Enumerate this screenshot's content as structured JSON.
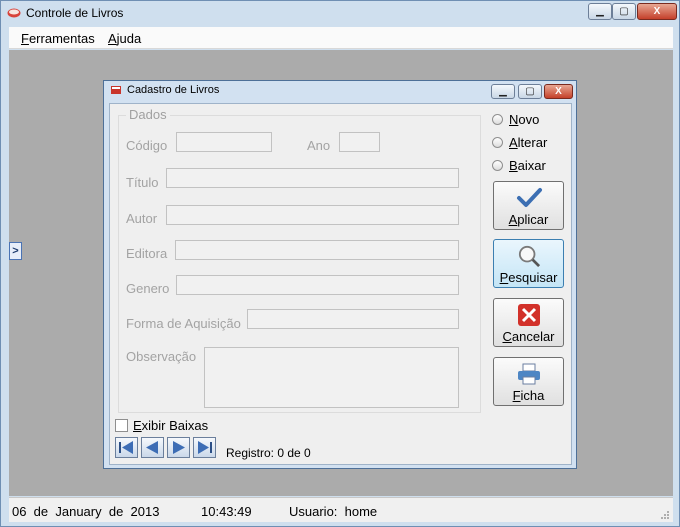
{
  "window": {
    "title": "Controle de Livros",
    "min_label": "▁",
    "max_label": "▢",
    "close_label": "X"
  },
  "menu": [
    {
      "label": "Ferramentas",
      "hotkey": "F",
      "rest": "erramentas"
    },
    {
      "label": "Ajuda",
      "hotkey": "A",
      "rest": "juda"
    }
  ],
  "side_arrow": ">",
  "form": {
    "title": "Cadastro de Livros",
    "min_label": "▁",
    "max_label": "▢",
    "close_label": "X",
    "group_title": "Dados",
    "fields": {
      "codigo": {
        "label": "Código",
        "value": ""
      },
      "ano": {
        "label": "Ano",
        "value": ""
      },
      "titulo": {
        "label": "Título",
        "value": ""
      },
      "autor": {
        "label": "Autor",
        "value": ""
      },
      "editora": {
        "label": "Editora",
        "value": ""
      },
      "genero": {
        "label": "Genero",
        "value": ""
      },
      "forma": {
        "label": "Forma de Aquisição",
        "value": ""
      },
      "observacao": {
        "label": "Observação",
        "value": ""
      }
    },
    "modes": [
      {
        "label": "Novo",
        "hotkey": "N",
        "rest": "ovo"
      },
      {
        "label": "Alterar",
        "hotkey": "A",
        "rest": "lterar"
      },
      {
        "label": "Baixar",
        "hotkey": "B",
        "rest": "aixar"
      }
    ],
    "buttons": {
      "aplicar": {
        "label": "Aplicar",
        "hotkey": "A",
        "rest": "plicar",
        "icon": "checkmark-icon"
      },
      "pesquisar": {
        "label": "Pesquisar",
        "hotkey": "P",
        "rest": "esquisar",
        "icon": "magnifier-icon"
      },
      "cancelar": {
        "label": "Cancelar",
        "hotkey": "C",
        "rest": "ancelar",
        "icon": "cancel-x-icon"
      },
      "ficha": {
        "label": "Ficha",
        "hotkey": "F",
        "rest": "icha",
        "icon": "printer-icon"
      }
    },
    "exibir_baixas": {
      "label": "Exibir Baixas",
      "hotkey": "E",
      "rest": "xibir Baixas",
      "checked": false
    },
    "nav": [
      "first-record-icon",
      "prev-record-icon",
      "next-record-icon",
      "last-record-icon"
    ],
    "registro": "Registro: 0 de 0"
  },
  "status": {
    "date": "06  de  January  de  2013",
    "time": "10:43:49",
    "user": "Usuario:  home"
  },
  "colors": {
    "accent": "#3c7fb1",
    "close": "#c4402a",
    "mdi_bg": "#ababab",
    "disabled_text": "#a3a3a3"
  }
}
